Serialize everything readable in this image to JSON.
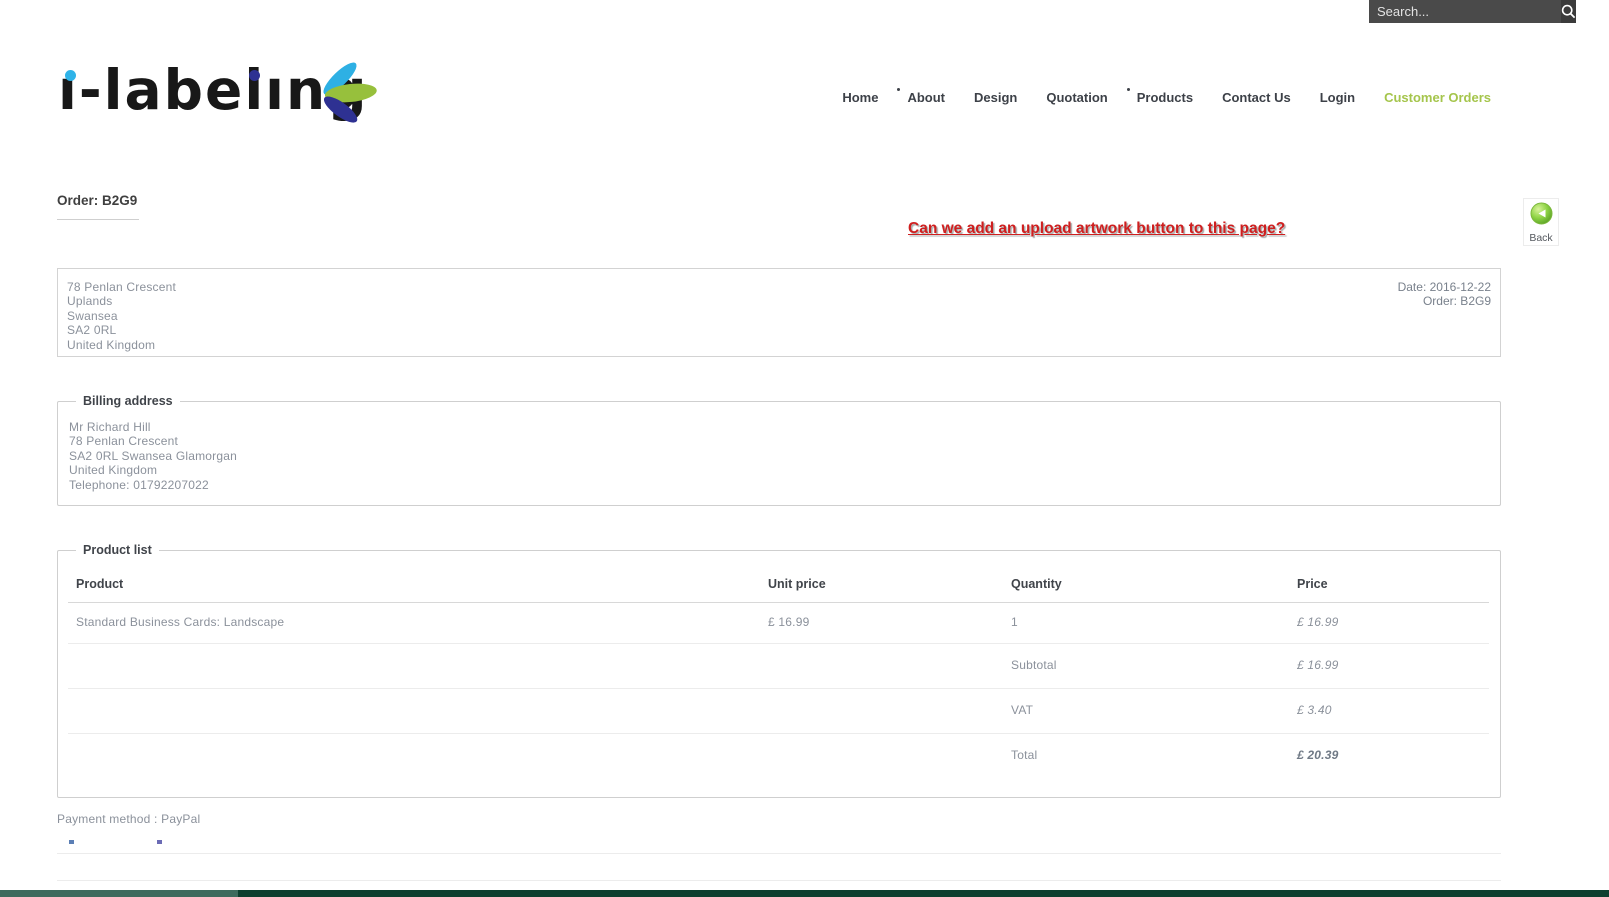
{
  "search": {
    "placeholder": "Search..."
  },
  "logo": {
    "text": "i-labeling",
    "display_text": "ı-labelıng"
  },
  "nav": {
    "items": [
      {
        "label": "Home",
        "has_dot": false,
        "active": false
      },
      {
        "label": "About",
        "has_dot": true,
        "active": false
      },
      {
        "label": "Design",
        "has_dot": false,
        "active": false
      },
      {
        "label": "Quotation",
        "has_dot": false,
        "active": false
      },
      {
        "label": "Products",
        "has_dot": true,
        "active": false
      },
      {
        "label": "Contact Us",
        "has_dot": false,
        "active": false
      },
      {
        "label": "Login",
        "has_dot": false,
        "active": false
      },
      {
        "label": "Customer Orders",
        "has_dot": false,
        "active": true
      }
    ]
  },
  "page": {
    "title": "Order: B2G9",
    "annotation": "Can we add an upload artwork button to this page?",
    "back_label": "Back"
  },
  "shipping": {
    "lines": [
      "78 Penlan Crescent",
      "Uplands",
      "Swansea",
      "SA2 0RL",
      "United Kingdom"
    ],
    "date": "Date: 2016-12-22",
    "order": "Order: B2G9"
  },
  "billing": {
    "legend": "Billing address",
    "lines": [
      "Mr Richard Hill",
      "78 Penlan Crescent",
      "SA2 0RL Swansea Glamorgan",
      "United Kingdom",
      "Telephone: 01792207022"
    ]
  },
  "products": {
    "legend": "Product list",
    "columns": [
      "Product",
      "Unit price",
      "Quantity",
      "Price"
    ],
    "rows": [
      {
        "product": "Standard Business Cards: Landscape",
        "unit_price": "£ 16.99",
        "quantity": "1",
        "price": "£ 16.99"
      }
    ],
    "totals": [
      {
        "label": "Subtotal",
        "value": "£ 16.99"
      },
      {
        "label": "VAT",
        "value": "£ 3.40"
      },
      {
        "label": "Total",
        "value": "£ 20.39"
      }
    ]
  },
  "bottom": {
    "payment_method": "Payment method : PayPal"
  },
  "colors": {
    "accent_green": "#a5c54c",
    "annotation_red": "#cf1f1f",
    "back_button_green": "#6fbf3a",
    "logo_dot_light_blue": "#2fb3e8",
    "logo_dot_dark_blue": "#2e3192",
    "leaf_green": "#97c03c",
    "footer_dark": "#0d3f2f",
    "footer_light": "#3e6b5e",
    "searchbar_gray": "#4a4a4a",
    "body_text_gray": "#8b919b"
  }
}
